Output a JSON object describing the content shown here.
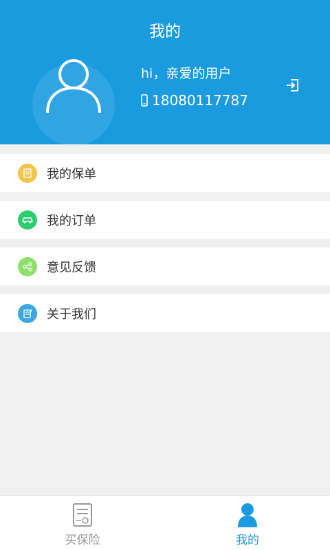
{
  "header": {
    "title": "我的",
    "greeting": "hi，亲爱的用户",
    "phone": "18080117787"
  },
  "menu": [
    {
      "label": "我的保单",
      "icon": "policy-icon",
      "color": "#f3c44a"
    },
    {
      "label": "我的订单",
      "icon": "car-icon",
      "color": "#2ecc71"
    },
    {
      "label": "意见反馈",
      "icon": "share-icon",
      "color": "#8ee06a"
    },
    {
      "label": "关于我们",
      "icon": "notes-icon",
      "color": "#3ba8e0"
    }
  ],
  "tabs": [
    {
      "label": "买保险",
      "icon": "document-icon",
      "active": false
    },
    {
      "label": "我的",
      "icon": "person-icon",
      "active": true
    }
  ],
  "colors": {
    "brand": "#1a9be0",
    "tab_inactive": "#999999"
  }
}
